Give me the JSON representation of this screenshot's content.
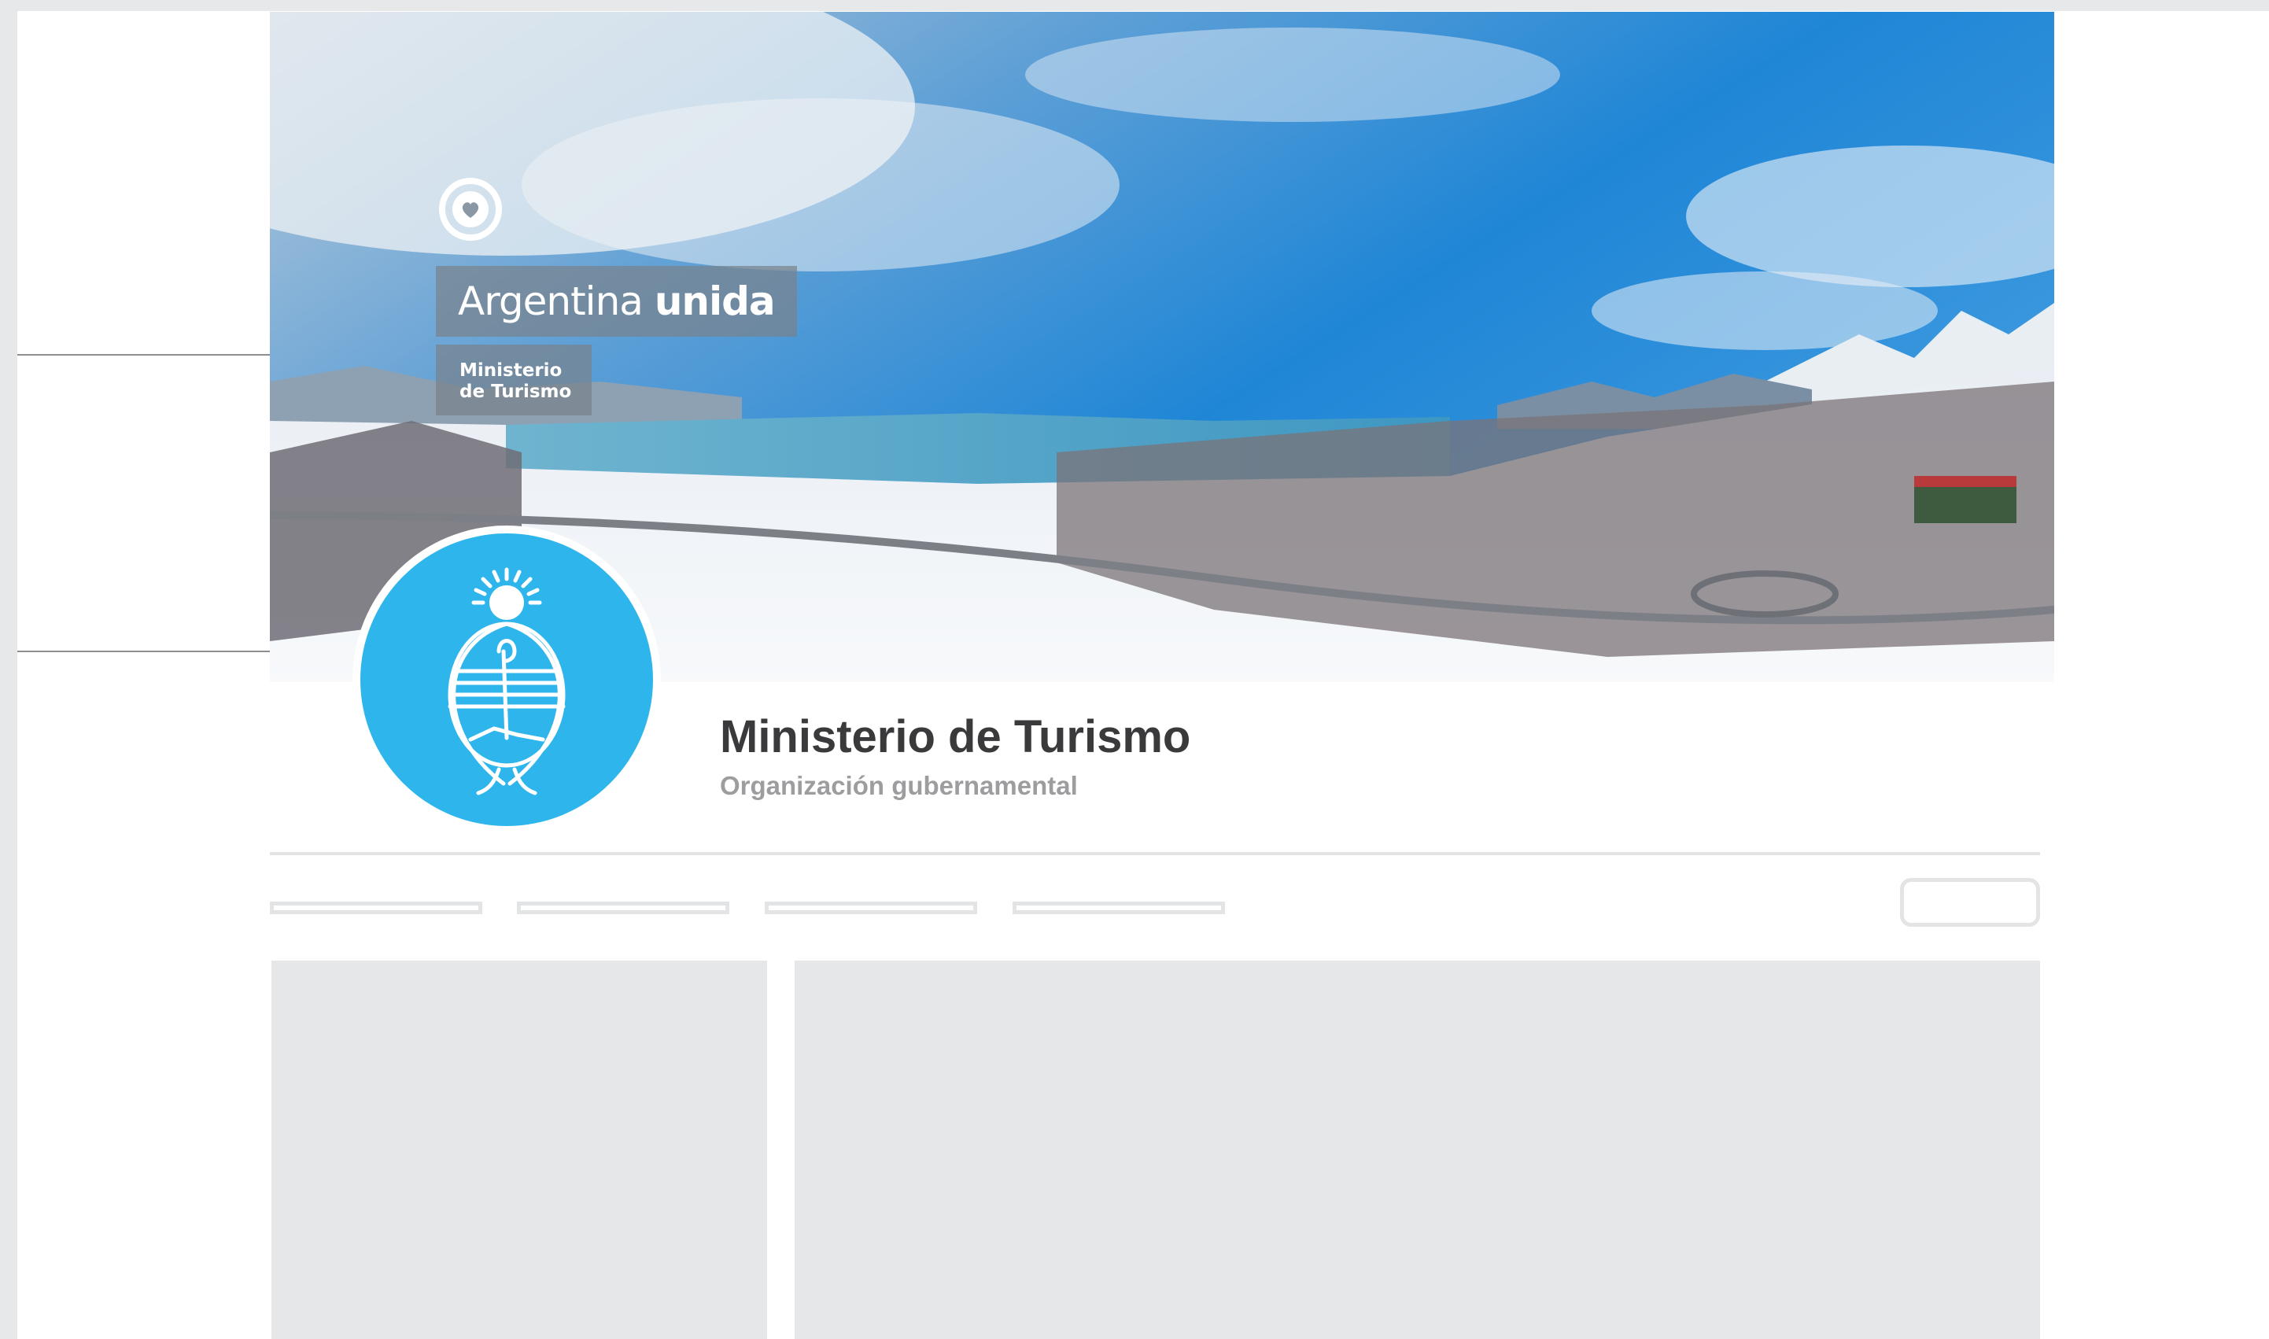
{
  "cover": {
    "brand_light": "Argentina",
    "brand_bold": "unida",
    "ministry_line1": "Ministerio",
    "ministry_line2": "de Turismo",
    "heart_icon": "heart-circle-icon"
  },
  "profile": {
    "name": "Ministerio de Turismo",
    "category": "Organización gubernamental",
    "avatar_icon": "argentina-coat-of-arms-icon"
  },
  "colors": {
    "avatar_bg": "#2eb6ec",
    "title_text": "#3a3a3c",
    "subtitle_text": "#9d9d9f",
    "placeholder": "#e6e7e9"
  }
}
